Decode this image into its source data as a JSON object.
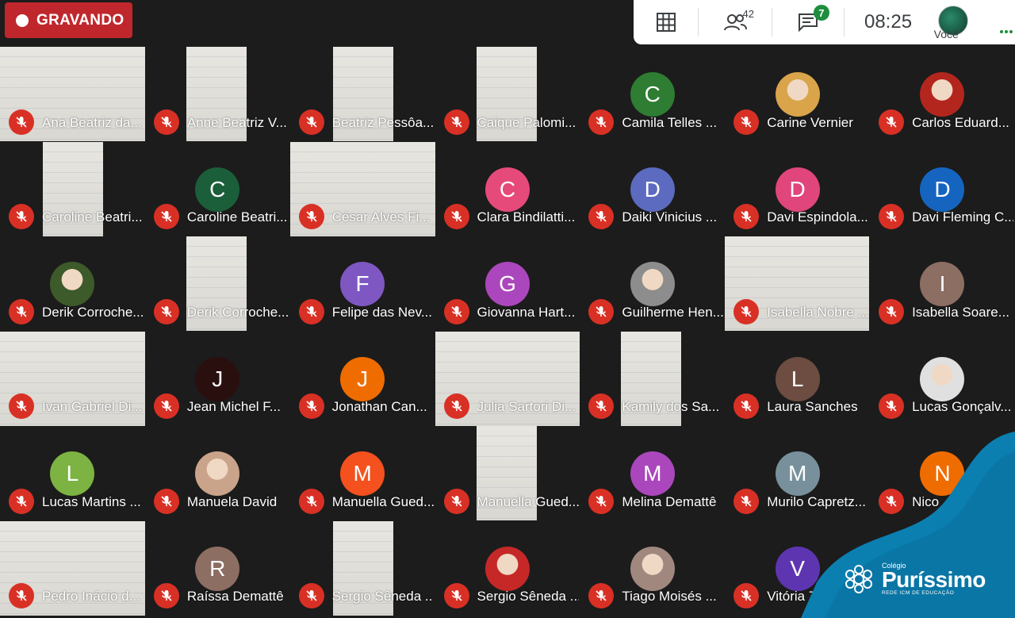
{
  "recording": {
    "label": "GRAVANDO",
    "color": "#c0272d"
  },
  "toolbar": {
    "icons": [
      "grid-layout-icon",
      "people-icon",
      "chat-icon"
    ],
    "people_count": "42",
    "chat_badge": "7",
    "time": "08:25",
    "you_label": "Você"
  },
  "participants": [
    {
      "name": "Ana Beatriz da...",
      "type": "video"
    },
    {
      "name": "Anne Beatriz V...",
      "type": "video"
    },
    {
      "name": "Beatriz Pessôa...",
      "type": "video"
    },
    {
      "name": "Caique Palomi...",
      "type": "video"
    },
    {
      "name": "Camila Telles ...",
      "type": "letter",
      "initial": "C",
      "color": "#2e7d32"
    },
    {
      "name": "Carine Vernier",
      "type": "photo",
      "color": "#d9a44a"
    },
    {
      "name": "Carlos Eduard...",
      "type": "photo",
      "color": "#b3261e"
    },
    {
      "name": "Caroline Beatri...",
      "type": "video"
    },
    {
      "name": "Caroline Beatri...",
      "type": "letter",
      "initial": "C",
      "color": "#1b5e3a"
    },
    {
      "name": "César Alves Fi...",
      "type": "video"
    },
    {
      "name": "Clara Bindilatti...",
      "type": "letter",
      "initial": "C",
      "color": "#e64a7b"
    },
    {
      "name": "Daiki Vinicius ...",
      "type": "letter",
      "initial": "D",
      "color": "#5c6bc0"
    },
    {
      "name": "Davi Espindola...",
      "type": "letter",
      "initial": "D",
      "color": "#e0457b"
    },
    {
      "name": "Davi Fleming C...",
      "type": "letter",
      "initial": "D",
      "color": "#1565c0"
    },
    {
      "name": "Derik Corroche...",
      "type": "photo",
      "color": "#3d5a2a"
    },
    {
      "name": "Derik Corroche...",
      "type": "video"
    },
    {
      "name": "Felipe das Nev...",
      "type": "letter",
      "initial": "F",
      "color": "#7e57c2"
    },
    {
      "name": "Giovanna Hart...",
      "type": "letter",
      "initial": "G",
      "color": "#ab47bc"
    },
    {
      "name": "Guilherme Hen...",
      "type": "photo",
      "color": "#8d8d8d"
    },
    {
      "name": "Isabella Nobre ...",
      "type": "video"
    },
    {
      "name": "Isabella Soare...",
      "type": "letter",
      "initial": "I",
      "color": "#8d6e63"
    },
    {
      "name": "Ivan Gabriel Di...",
      "type": "video"
    },
    {
      "name": "Jean Michel F...",
      "type": "letter",
      "initial": "J",
      "color": "#2a0f0f"
    },
    {
      "name": "Jonathan Can...",
      "type": "letter",
      "initial": "J",
      "color": "#ef6c00"
    },
    {
      "name": "Julia Sartori Di...",
      "type": "video"
    },
    {
      "name": "Kamily dos Sa...",
      "type": "video"
    },
    {
      "name": "Laura Sanches",
      "type": "letter",
      "initial": "L",
      "color": "#6d4c41"
    },
    {
      "name": "Lucas Gonçalv...",
      "type": "photo",
      "color": "#e0e0e0"
    },
    {
      "name": "Lucas Martins ...",
      "type": "letter",
      "initial": "L",
      "color": "#7cb342"
    },
    {
      "name": "Manuela David",
      "type": "photo",
      "color": "#c9a38a"
    },
    {
      "name": "Manuella Gued...",
      "type": "letter",
      "initial": "M",
      "color": "#f4511e"
    },
    {
      "name": "Manuella Gued...",
      "type": "video"
    },
    {
      "name": "Melina Demattê",
      "type": "letter",
      "initial": "M",
      "color": "#ab47bc"
    },
    {
      "name": "Murilo Capretz...",
      "type": "letter",
      "initial": "M",
      "color": "#78909c"
    },
    {
      "name": "Nico",
      "type": "letter",
      "initial": "N",
      "color": "#ef6c00"
    },
    {
      "name": "Pedro Inácio d...",
      "type": "video"
    },
    {
      "name": "Raíssa Demattê",
      "type": "letter",
      "initial": "R",
      "color": "#8d6e63"
    },
    {
      "name": "Sergio Sêneda ...",
      "type": "video"
    },
    {
      "name": "Sergio Sêneda ...",
      "type": "photo",
      "color": "#c62828"
    },
    {
      "name": "Tiago Moisés ...",
      "type": "photo",
      "color": "#a1887f"
    },
    {
      "name": "Vitória 7",
      "type": "letter",
      "initial": "V",
      "color": "#5e35b1"
    },
    {
      "name": "",
      "type": "empty"
    }
  ],
  "brand": {
    "sub": "Colégio",
    "main": "Puríssimo",
    "tag": "REDE ICM DE EDUCAÇÃO",
    "color": "#0b7fb0"
  }
}
